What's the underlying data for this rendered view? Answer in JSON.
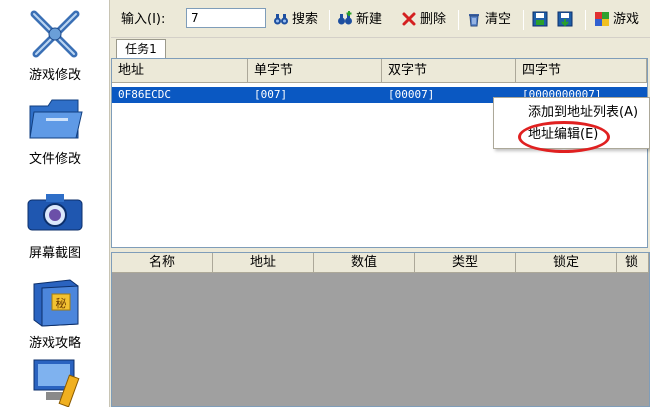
{
  "sidebar": {
    "items": [
      {
        "label": "游戏修改",
        "icon": "swords-icon"
      },
      {
        "label": "文件修改",
        "icon": "folder-icon"
      },
      {
        "label": "屏幕截图",
        "icon": "camera-icon"
      },
      {
        "label": "游戏攻略",
        "icon": "secret-book-icon"
      },
      {
        "icon": "computer-icon"
      }
    ]
  },
  "toolbar": {
    "input_label": "输入(I):",
    "input_value": "7",
    "search_label": "搜索",
    "new_label": "新建",
    "delete_label": "删除",
    "clear_label": "清空",
    "game_label": "游戏"
  },
  "tabs": [
    {
      "label": "任务1"
    }
  ],
  "upper_list": {
    "columns": [
      "地址",
      "单字节",
      "双字节",
      "四字节"
    ],
    "rows": [
      {
        "address": "0F86ECDC",
        "byte1": "[007]",
        "byte2": "[00007]",
        "byte4": "[0000000007]"
      }
    ]
  },
  "context_menu": {
    "items": [
      "添加到地址列表(A)",
      "地址编辑(E)"
    ]
  },
  "lower_list": {
    "columns": [
      "名称",
      "地址",
      "数值",
      "类型",
      "锁定",
      "锁"
    ]
  },
  "colors": {
    "selection": "#0a58c2",
    "highlight_circle": "#e02020",
    "list_bg_empty": "#a0a0a0"
  }
}
